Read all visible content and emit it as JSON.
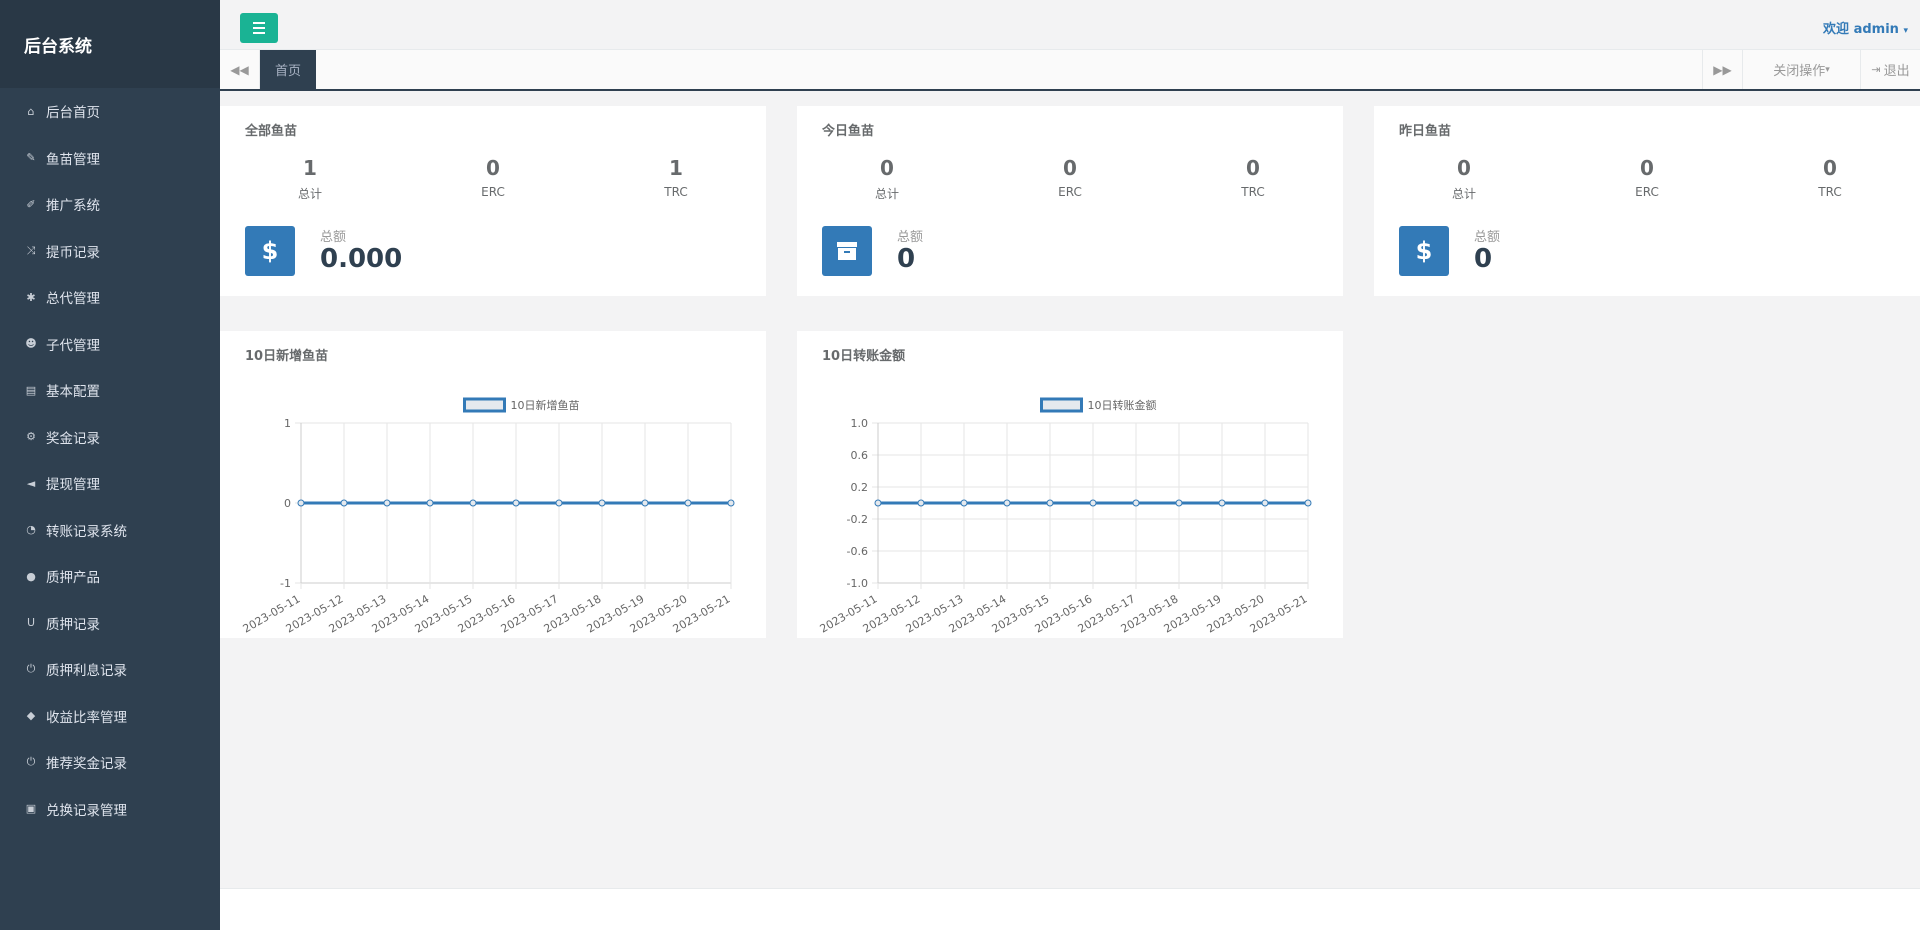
{
  "sidebar": {
    "title": "后台系统",
    "items": [
      {
        "label": "后台首页",
        "icon": "home-icon"
      },
      {
        "label": "鱼苗管理",
        "icon": "wrench-icon"
      },
      {
        "label": "推广系统",
        "icon": "edit-icon"
      },
      {
        "label": "提币记录",
        "icon": "random-icon"
      },
      {
        "label": "总代管理",
        "icon": "asterisk-icon"
      },
      {
        "label": "子代管理",
        "icon": "users-icon"
      },
      {
        "label": "基本配置",
        "icon": "file-icon"
      },
      {
        "label": "奖金记录",
        "icon": "cogs-icon"
      },
      {
        "label": "提现管理",
        "icon": "bullhorn-icon"
      },
      {
        "label": "转账记录系统",
        "icon": "dashboard-icon"
      },
      {
        "label": "质押产品",
        "icon": "comment-icon"
      },
      {
        "label": "质押记录",
        "icon": "magnet-icon"
      },
      {
        "label": "质押利息记录",
        "icon": "power-icon"
      },
      {
        "label": "收益比率管理",
        "icon": "shield-icon"
      },
      {
        "label": "推荐奖金记录",
        "icon": "power-icon"
      },
      {
        "label": "兑换记录管理",
        "icon": "save-icon"
      }
    ]
  },
  "topbar": {
    "welcome": "欢迎",
    "user": "admin"
  },
  "tabs": {
    "home": "首页",
    "close_ops": "关闭操作",
    "logout": "退出"
  },
  "cards": [
    {
      "title": "全部鱼苗",
      "total": "1",
      "erc": "0",
      "trc": "1",
      "total_label": "总计",
      "erc_label": "ERC",
      "trc_label": "TRC",
      "amount_label": "总额",
      "amount": "0.000",
      "icon": "dollar-icon",
      "icon_glyph": "$"
    },
    {
      "title": "今日鱼苗",
      "total": "0",
      "erc": "0",
      "trc": "0",
      "total_label": "总计",
      "erc_label": "ERC",
      "trc_label": "TRC",
      "amount_label": "总额",
      "amount": "0",
      "icon": "archive-icon",
      "icon_glyph": ""
    },
    {
      "title": "昨日鱼苗",
      "total": "0",
      "erc": "0",
      "trc": "0",
      "total_label": "总计",
      "erc_label": "ERC",
      "trc_label": "TRC",
      "amount_label": "总额",
      "amount": "0",
      "icon": "dollar-icon",
      "icon_glyph": "$"
    }
  ],
  "chart_data": [
    {
      "type": "line",
      "title": "10日新增鱼苗",
      "legend": "10日新增鱼苗",
      "x": [
        "2023-05-11",
        "2023-05-12",
        "2023-05-13",
        "2023-05-14",
        "2023-05-15",
        "2023-05-16",
        "2023-05-17",
        "2023-05-18",
        "2023-05-19",
        "2023-05-20",
        "2023-05-21"
      ],
      "series": [
        {
          "name": "10日新增鱼苗",
          "values": [
            0,
            0,
            0,
            0,
            0,
            0,
            0,
            0,
            0,
            0,
            0
          ]
        }
      ],
      "yticks": [
        "1",
        "0",
        "-1"
      ],
      "ylim": [
        -1,
        1
      ],
      "grid": true,
      "legend_position": "top",
      "color": "#337ab7"
    },
    {
      "type": "line",
      "title": "10日转账金额",
      "legend": "10日转账金额",
      "x": [
        "2023-05-11",
        "2023-05-12",
        "2023-05-13",
        "2023-05-14",
        "2023-05-15",
        "2023-05-16",
        "2023-05-17",
        "2023-05-18",
        "2023-05-19",
        "2023-05-20",
        "2023-05-21"
      ],
      "series": [
        {
          "name": "10日转账金额",
          "values": [
            0,
            0,
            0,
            0,
            0,
            0,
            0,
            0,
            0,
            0,
            0
          ]
        }
      ],
      "yticks": [
        "1.0",
        "0.6",
        "0.2",
        "-0.2",
        "-0.6",
        "-1.0"
      ],
      "ylim": [
        -1,
        1
      ],
      "grid": true,
      "legend_position": "top",
      "color": "#337ab7"
    }
  ]
}
